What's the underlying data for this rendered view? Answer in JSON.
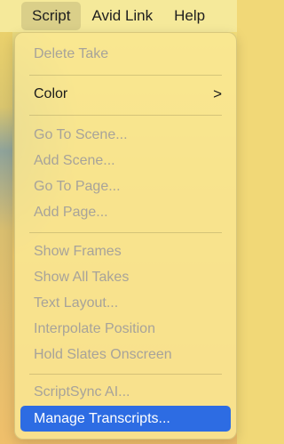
{
  "menubar": {
    "items": [
      {
        "label": "Script"
      },
      {
        "label": "Avid Link"
      },
      {
        "label": "Help"
      }
    ]
  },
  "menu": {
    "delete_take": "Delete Take",
    "color": "Color",
    "submenu_indicator": ">",
    "go_to_scene": "Go To Scene...",
    "add_scene": "Add Scene...",
    "go_to_page": "Go To Page...",
    "add_page": "Add Page...",
    "show_frames": "Show Frames",
    "show_all_takes": "Show All Takes",
    "text_layout": "Text Layout...",
    "interpolate_position": "Interpolate Position",
    "hold_slates_onscreen": "Hold Slates Onscreen",
    "scriptsync_ai": "ScriptSync AI...",
    "manage_transcripts": "Manage Transcripts..."
  },
  "colors": {
    "highlight": "#2d6ce3",
    "disabled_text": "#a7a39a",
    "menu_background": "#fae896"
  }
}
